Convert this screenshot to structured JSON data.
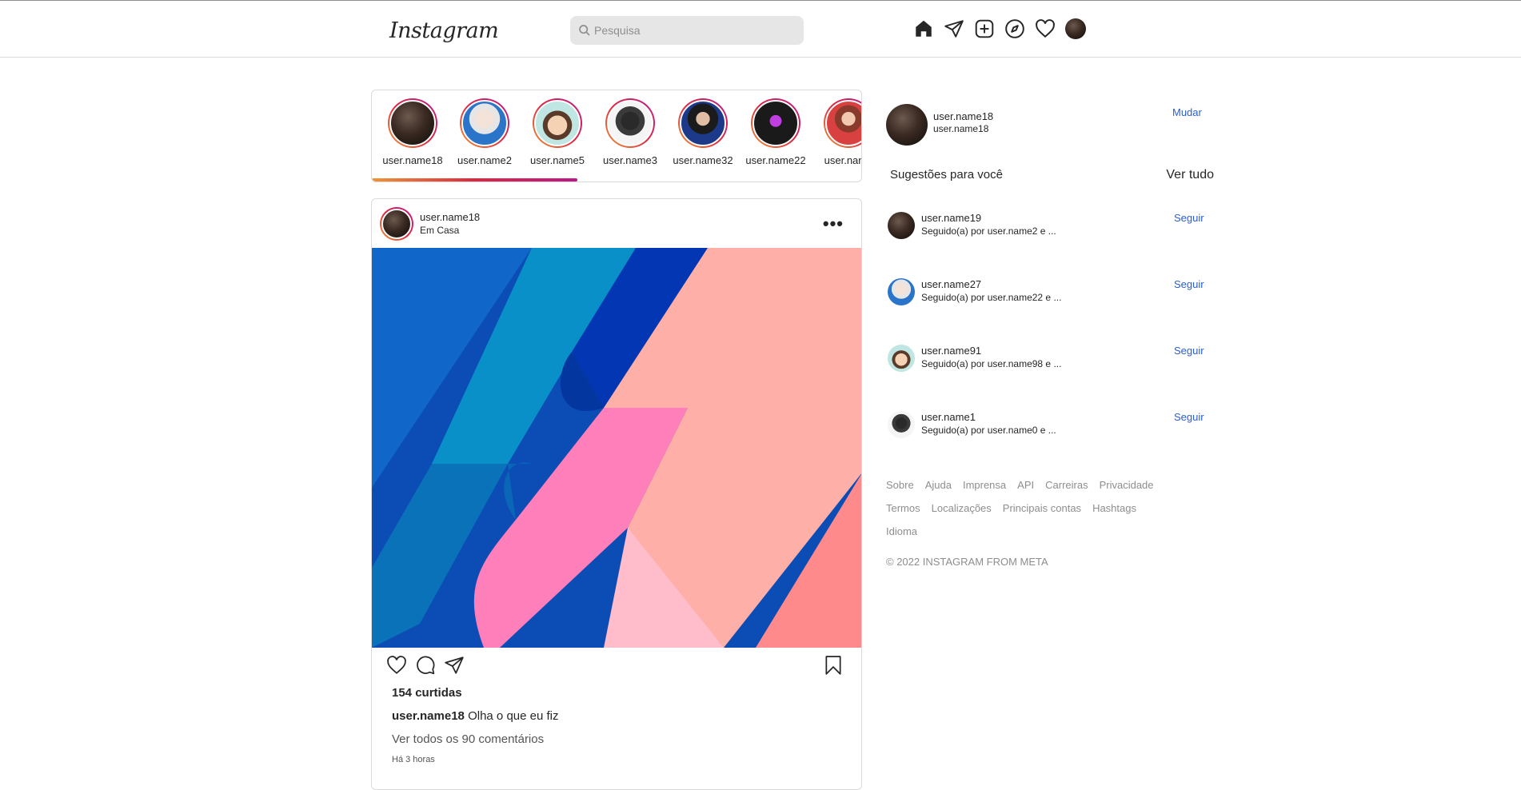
{
  "header": {
    "logo_text": "Instagram",
    "search_placeholder": "Pesquisa",
    "nav_icons": [
      "home-icon",
      "direct-icon",
      "new-post-icon",
      "explore-icon",
      "activity-icon",
      "profile-avatar"
    ]
  },
  "stories": [
    {
      "name": "user.name18"
    },
    {
      "name": "user.name2"
    },
    {
      "name": "user.name5"
    },
    {
      "name": "user.name3"
    },
    {
      "name": "user.name32"
    },
    {
      "name": "user.name22"
    },
    {
      "name": "user.name"
    }
  ],
  "post": {
    "username": "user.name18",
    "location": "Em Casa",
    "likes": "154 curtidas",
    "caption_user": "user.name18",
    "caption_text": "Olha o que eu fiz",
    "comments_link": "Ver todos os 90 comentários",
    "time": "Há 3 horas"
  },
  "sidebar": {
    "me_username": "user.name18",
    "me_fullname": "user.name18",
    "switch_label": "Mudar",
    "suggestions_title": "Sugestões para você",
    "see_all_label": "Ver tudo",
    "suggestions": [
      {
        "name": "user.name19",
        "followed_by": "Seguido(a) por user.name2 e ...",
        "action": "Seguir"
      },
      {
        "name": "user.name27",
        "followed_by": "Seguido(a) por user.name22 e ...",
        "action": "Seguir"
      },
      {
        "name": "user.name91",
        "followed_by": "Seguido(a) por user.name98 e ...",
        "action": "Seguir"
      },
      {
        "name": "user.name1",
        "followed_by": "Seguido(a) por user.name0 e ...",
        "action": "Seguir"
      }
    ],
    "footer_links": [
      "Sobre",
      "Ajuda",
      "Imprensa",
      "API",
      "Carreiras",
      "Privacidade",
      "Termos",
      "Localizações",
      "Principais contas",
      "Hashtags",
      "Idioma"
    ],
    "copyright": "© 2022 INSTAGRAM FROM META"
  },
  "colors": {
    "accent_link": "#2a5ecf",
    "story_ring": [
      "#f09433",
      "#dc2743",
      "#bc1888"
    ]
  }
}
